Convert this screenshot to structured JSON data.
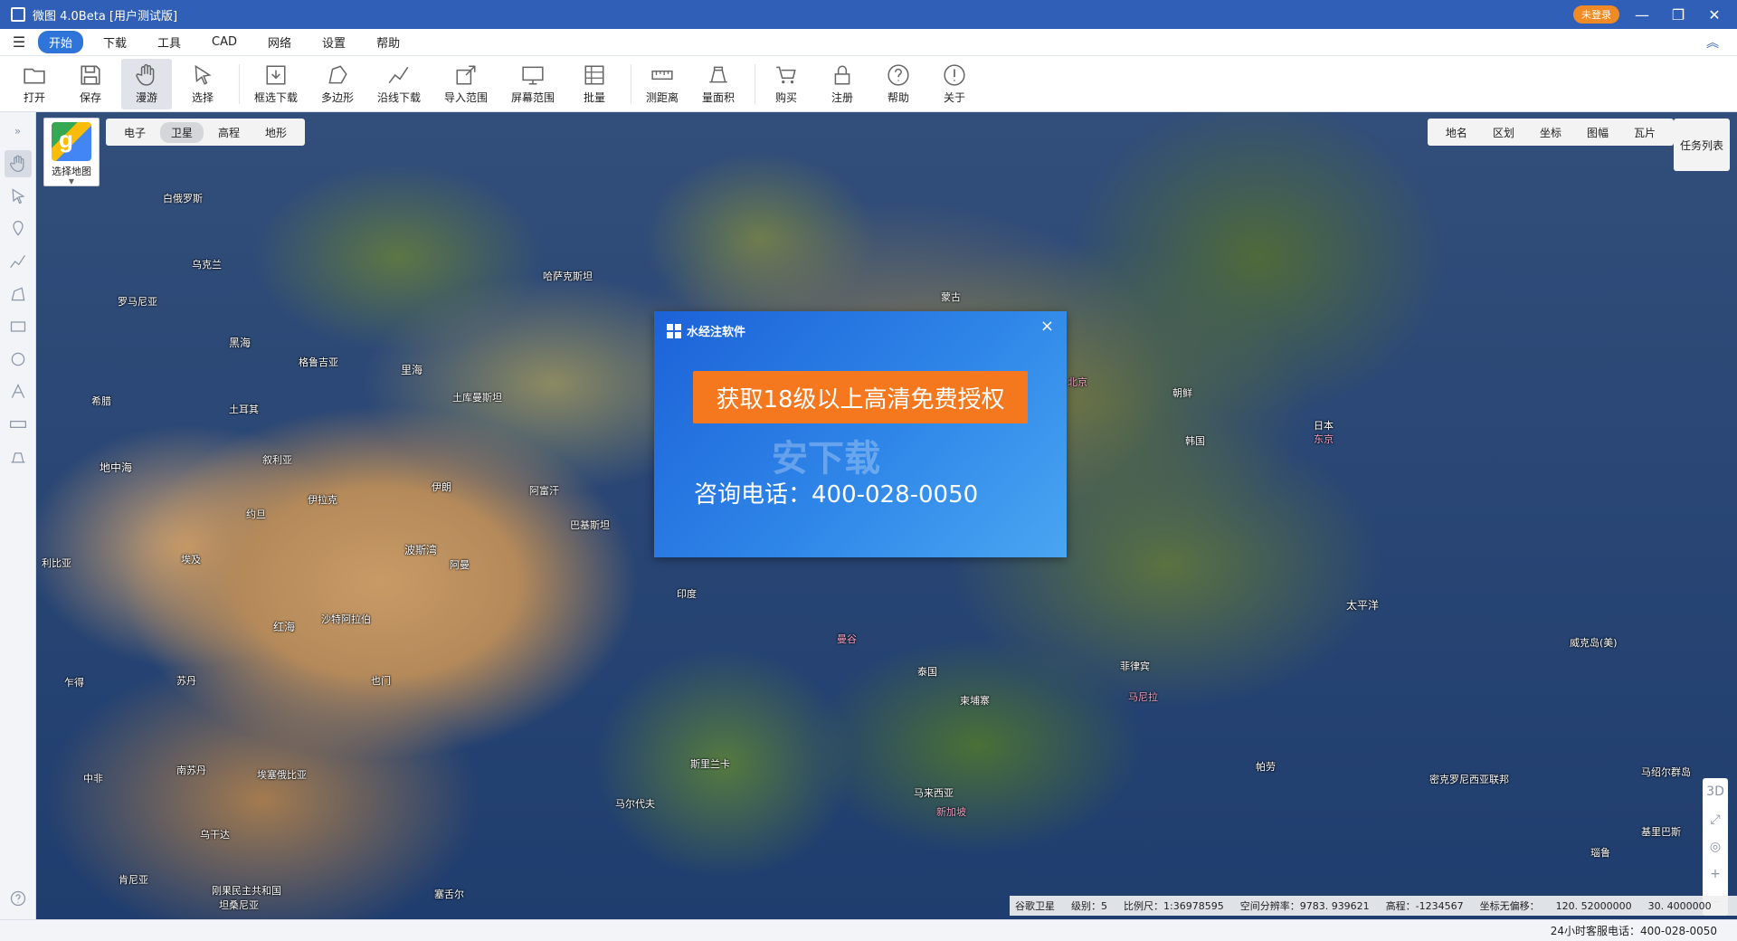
{
  "window": {
    "title": "微图 4.0Beta [用户测试版]",
    "login_badge": "未登录",
    "minimize": "—",
    "restore": "❐",
    "close": "✕"
  },
  "menu": {
    "items": [
      "开始",
      "下载",
      "工具",
      "CAD",
      "网络",
      "设置",
      "帮助"
    ],
    "active": "开始"
  },
  "toolbar": {
    "tools": [
      {
        "label": "打开",
        "icon": "folder-icon"
      },
      {
        "label": "保存",
        "icon": "save-icon"
      },
      {
        "label": "漫游",
        "icon": "hand-icon"
      },
      {
        "label": "选择",
        "icon": "pointer-icon"
      },
      {
        "label": "框选下载",
        "icon": "box-download-icon"
      },
      {
        "label": "多边形",
        "icon": "polygon-icon"
      },
      {
        "label": "沿线下载",
        "icon": "line-download-icon"
      },
      {
        "label": "导入范围",
        "icon": "import-icon"
      },
      {
        "label": "屏幕范围",
        "icon": "screen-icon"
      },
      {
        "label": "批量",
        "icon": "batch-icon"
      },
      {
        "label": "测距离",
        "icon": "ruler-icon"
      },
      {
        "label": "量面积",
        "icon": "area-icon"
      },
      {
        "label": "购买",
        "icon": "cart-icon"
      },
      {
        "label": "注册",
        "icon": "lock-icon"
      },
      {
        "label": "帮助",
        "icon": "help-icon"
      },
      {
        "label": "关于",
        "icon": "info-icon"
      }
    ]
  },
  "map_controls": {
    "map_switch_label": "选择地图",
    "layer_tabs": [
      "电子",
      "卫星",
      "高程",
      "地形"
    ],
    "active_layer": "卫星",
    "overlay_tabs": [
      "地名",
      "区划",
      "坐标",
      "图幅",
      "瓦片"
    ],
    "task_list": "任务列表",
    "zoom": [
      "3D",
      "⤢",
      "◎",
      "+",
      "−"
    ]
  },
  "map_labels": [
    {
      "text": "白俄罗斯",
      "pink": false
    },
    {
      "text": "乌克兰",
      "pink": false
    },
    {
      "text": "哈萨克斯坦",
      "pink": false
    },
    {
      "text": "蒙古",
      "pink": false
    },
    {
      "text": "罗马尼亚",
      "pink": false
    },
    {
      "text": "黑海",
      "pink": false
    },
    {
      "text": "里海",
      "pink": false
    },
    {
      "text": "格鲁吉亚",
      "pink": false
    },
    {
      "text": "土库曼斯坦",
      "pink": false
    },
    {
      "text": "土耳其",
      "pink": false
    },
    {
      "text": "希腊",
      "pink": false
    },
    {
      "text": "地中海",
      "pink": false
    },
    {
      "text": "叙利亚",
      "pink": false
    },
    {
      "text": "伊拉克",
      "pink": false
    },
    {
      "text": "伊朗",
      "pink": false
    },
    {
      "text": "阿富汗",
      "pink": false
    },
    {
      "text": "巴基斯坦",
      "pink": false
    },
    {
      "text": "约旦",
      "pink": false
    },
    {
      "text": "埃及",
      "pink": false
    },
    {
      "text": "利比亚",
      "pink": false
    },
    {
      "text": "波斯湾",
      "pink": false
    },
    {
      "text": "阿曼",
      "pink": false
    },
    {
      "text": "沙特阿拉伯",
      "pink": false
    },
    {
      "text": "红海",
      "pink": false
    },
    {
      "text": "印度",
      "pink": false
    },
    {
      "text": "北京",
      "pink": true
    },
    {
      "text": "朝鲜",
      "pink": false
    },
    {
      "text": "韩国",
      "pink": false
    },
    {
      "text": "日本",
      "pink": false
    },
    {
      "text": "东京",
      "pink": true
    },
    {
      "text": "太平洋",
      "pink": false
    },
    {
      "text": "威克岛(美)",
      "pink": false
    },
    {
      "text": "菲律宾",
      "pink": false
    },
    {
      "text": "泰国",
      "pink": false
    },
    {
      "text": "柬埔寨",
      "pink": false
    },
    {
      "text": "马来西亚",
      "pink": false
    },
    {
      "text": "斯里兰卡",
      "pink": false
    },
    {
      "text": "马尔代夫",
      "pink": false
    },
    {
      "text": "帕劳",
      "pink": false
    },
    {
      "text": "密克罗尼西亚联邦",
      "pink": false
    },
    {
      "text": "马绍尔群岛",
      "pink": false
    },
    {
      "text": "基里巴斯",
      "pink": false
    },
    {
      "text": "瑙鲁",
      "pink": false
    },
    {
      "text": "苏丹",
      "pink": false
    },
    {
      "text": "南苏丹",
      "pink": false
    },
    {
      "text": "埃塞俄比亚",
      "pink": false
    },
    {
      "text": "也门",
      "pink": false
    },
    {
      "text": "乍得",
      "pink": false
    },
    {
      "text": "中非",
      "pink": false
    },
    {
      "text": "乌干达",
      "pink": false
    },
    {
      "text": "肯尼亚",
      "pink": false
    },
    {
      "text": "刚果民主共和国",
      "pink": false
    },
    {
      "text": "坦桑尼亚",
      "pink": false
    },
    {
      "text": "塞舌尔",
      "pink": false
    },
    {
      "text": "新加坡",
      "pink": true
    },
    {
      "text": "曼谷",
      "pink": true
    },
    {
      "text": "马尼拉",
      "pink": true
    }
  ],
  "popup": {
    "brand": "水经注软件",
    "cta": "获取18级以上高清免费授权",
    "phone": "咨询电话：400-028-0050",
    "watermark": "安下载",
    "close": "×"
  },
  "info_bar": {
    "source": "谷歌卫星",
    "level": "级别：5",
    "scale": "比例尺：1:36978595",
    "resolution": "空间分辨率：9783. 939621",
    "elevation": "高程：-1234567",
    "offset": "坐标无偏移：",
    "lon": "120. 52000000",
    "lat": "30. 4000000"
  },
  "status": {
    "hotline": "24小时客服电话：400-028-0050"
  },
  "colors": {
    "titlebar": "#2f5fb6",
    "accent": "#2f74d9",
    "cta": "#f5781e",
    "popup": "#1c62d8"
  }
}
